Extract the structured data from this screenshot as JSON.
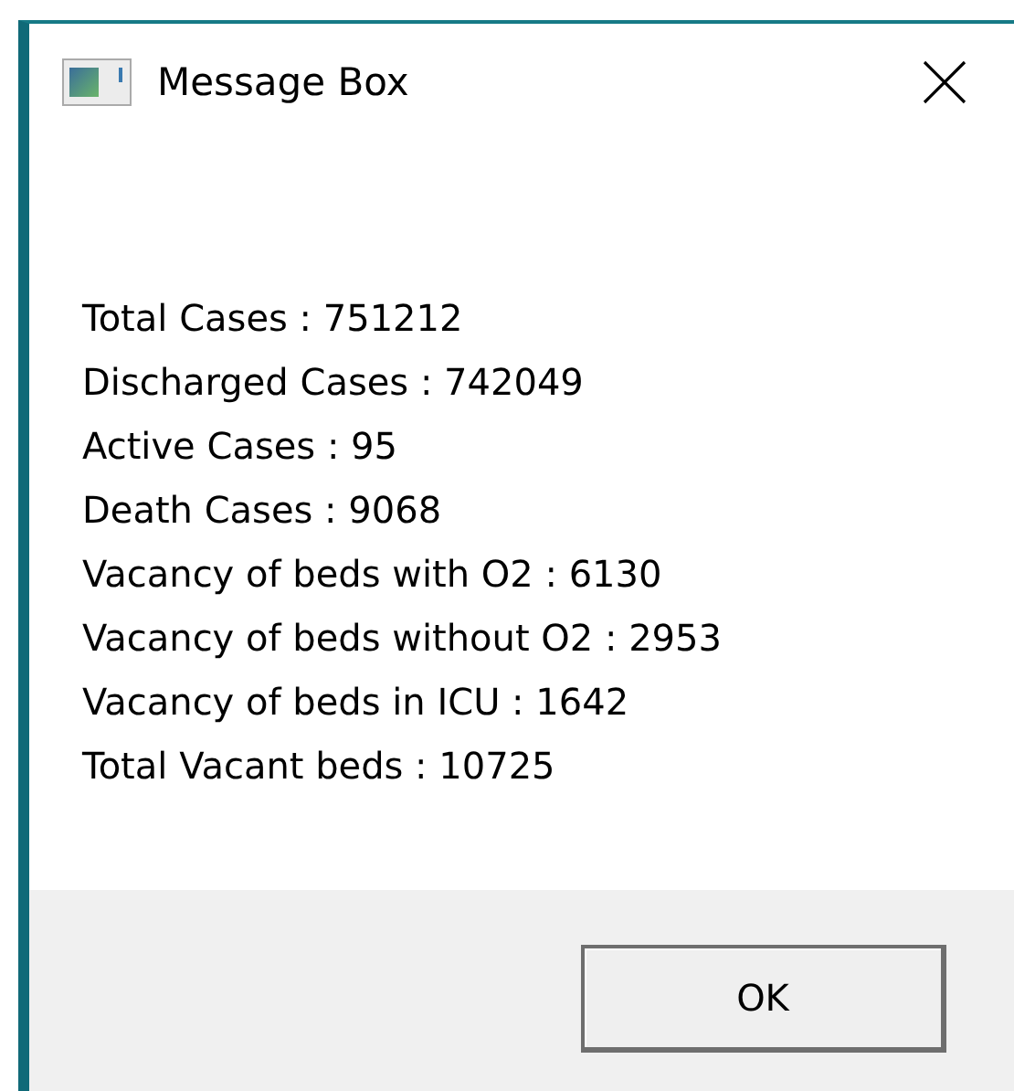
{
  "window": {
    "title": "Message Box"
  },
  "message_lines": [
    "Total Cases : 751212",
    "Discharged Cases : 742049",
    "Active Cases : 95",
    "Death Cases : 9068",
    "Vacancy of beds with O2 : 6130",
    "Vacancy of beds without O2 : 2953",
    "Vacancy of beds in ICU : 1642",
    "Total Vacant beds : 10725"
  ],
  "buttons": [
    "OK"
  ]
}
